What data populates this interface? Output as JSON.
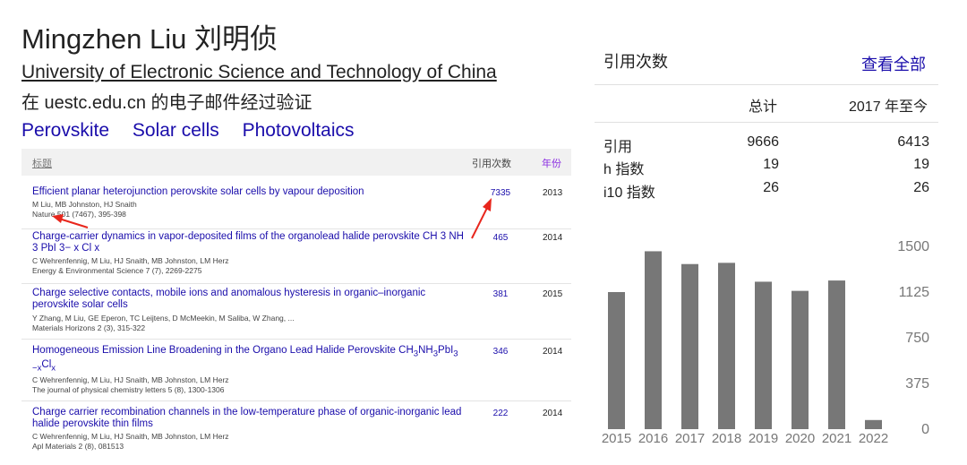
{
  "profile": {
    "name": "Mingzhen Liu 刘明侦",
    "affiliation": "University of Electronic Science and Technology of China",
    "verified_email": "在 uestc.edu.cn 的电子邮件经过验证",
    "interests": [
      "Perovskite",
      "Solar cells",
      "Photovoltaics"
    ]
  },
  "table": {
    "header_title": "标题",
    "header_cites": "引用次数",
    "header_year": "年份",
    "rows": [
      {
        "title": "Efficient planar heterojunction perovskite solar cells by vapour deposition",
        "authors": "M Liu, MB Johnston, HJ Snaith",
        "venue": "Nature 501 (7467), 395-398",
        "cites": "7335",
        "year": "2013"
      },
      {
        "title": "Charge-carrier dynamics in vapor-deposited films of the organolead halide perovskite CH 3 NH 3 PbI 3− x Cl x",
        "authors": "C Wehrenfennig, M Liu, HJ Snaith, MB Johnston, LM Herz",
        "venue": "Energy & Environmental Science 7 (7), 2269-2275",
        "cites": "465",
        "year": "2014"
      },
      {
        "title": "Charge selective contacts, mobile ions and anomalous hysteresis in organic–inorganic perovskite solar cells",
        "authors": "Y Zhang, M Liu, GE Eperon, TC Leijtens, D McMeekin, M Saliba, W Zhang, ...",
        "venue": "Materials Horizons 2 (3), 315-322",
        "cites": "381",
        "year": "2015"
      },
      {
        "title_main": "Homogeneous Emission Line Broadening in the Organo Lead Halide Perovskite CH",
        "title_sub1": "3",
        "title_mid1": "NH",
        "title_sub2": "3",
        "title_mid2": "PbI",
        "title_sub3": "3",
        "title_sub4": "−x",
        "title_end": "Cl",
        "title_sub5": "x",
        "authors": "C Wehrenfennig, M Liu, HJ Snaith, MB Johnston, LM Herz",
        "venue": "The journal of physical chemistry letters 5 (8), 1300-1306",
        "cites": "346",
        "year": "2014"
      },
      {
        "title": "Charge carrier recombination channels in the low-temperature phase of organic-inorganic lead halide perovskite thin films",
        "authors": "C Wehrenfennig, M Liu, HJ Snaith, MB Johnston, LM Herz",
        "venue": "Apl Materials 2 (8), 081513",
        "cites": "222",
        "year": "2014"
      }
    ]
  },
  "citations": {
    "title": "引用次数",
    "view_all": "查看全部",
    "col_total": "总计",
    "col_since": "2017 年至今",
    "metrics": [
      {
        "label": "引用",
        "total": "9666",
        "since": "6413"
      },
      {
        "label": "h 指数",
        "total": "19",
        "since": "19"
      },
      {
        "label": "i10 指数",
        "total": "26",
        "since": "26"
      }
    ]
  },
  "colors": {
    "link": "#1a0dab",
    "bar": "#777777",
    "annotation_arrow": "#e8261c"
  },
  "chart_data": {
    "type": "bar",
    "categories": [
      "2015",
      "2016",
      "2017",
      "2018",
      "2019",
      "2020",
      "2021",
      "2022"
    ],
    "values": [
      1125,
      1460,
      1355,
      1365,
      1210,
      1135,
      1220,
      75
    ],
    "yticks": [
      0,
      375,
      750,
      1125,
      1500
    ],
    "ylim": [
      0,
      1500
    ],
    "grid": false
  }
}
